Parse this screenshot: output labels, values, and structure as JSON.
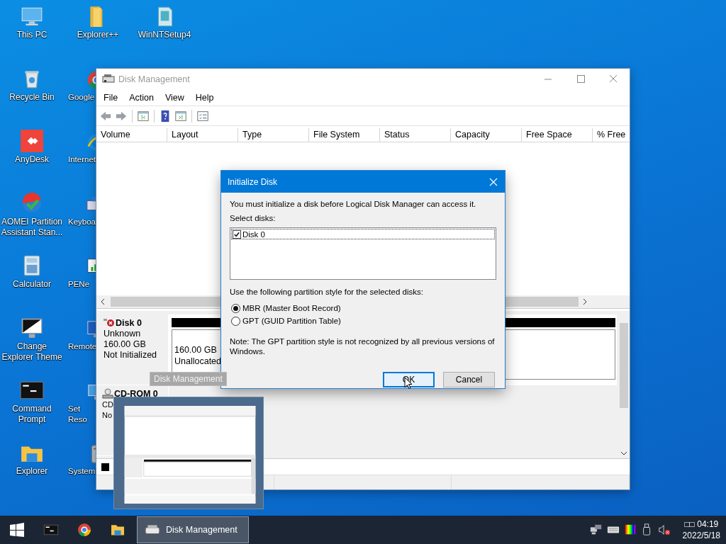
{
  "desktop": {
    "columns": [
      [
        {
          "label": "This PC",
          "kind": "pc"
        },
        {
          "label": "Recycle Bin",
          "kind": "bin"
        },
        {
          "label": "AnyDesk",
          "kind": "anydesk"
        },
        {
          "label": "AOMEI Partition Assistant Stan...",
          "kind": "aomei"
        },
        {
          "label": "Calculator",
          "kind": "calc"
        },
        {
          "label": "Change Explorer Theme",
          "kind": "theme"
        },
        {
          "label": "Command Prompt",
          "kind": "cmd"
        },
        {
          "label": "Explorer",
          "kind": "explorer"
        }
      ],
      [
        {
          "label": "Explorer++",
          "kind": "folder"
        },
        {
          "label": "Google",
          "kind": "chrome"
        },
        {
          "label": "Internet",
          "kind": "ie"
        },
        {
          "label": "Keyboa",
          "kind": "keyboard"
        },
        {
          "label": "PENe",
          "kind": "network"
        },
        {
          "label": "Remote",
          "kind": "remote"
        },
        {
          "label": "Set Reso",
          "kind": "screen"
        },
        {
          "label": "System",
          "kind": "system"
        }
      ],
      [
        {
          "label": "WinNTSetup4",
          "kind": "setup"
        }
      ]
    ]
  },
  "window": {
    "title": "Disk Management",
    "active": false,
    "menu": [
      "File",
      "Action",
      "View",
      "Help"
    ],
    "columns": [
      "Volume",
      "Layout",
      "Type",
      "File System",
      "Status",
      "Capacity",
      "Free Space",
      "% Free"
    ],
    "disks": [
      {
        "name": "Disk 0",
        "kind": "disk",
        "lines": [
          "Unknown",
          "160.00 GB",
          "Not Initialized"
        ],
        "partition": [
          "160.00 GB",
          "Unallocated"
        ]
      },
      {
        "name": "CD-ROM 0",
        "kind": "cdrom",
        "lines": [
          "CD",
          "No"
        ]
      }
    ]
  },
  "tooltip": "Disk Management",
  "dialog": {
    "title": "Initialize Disk",
    "message": "You must initialize a disk before Logical Disk Manager can access it.",
    "select_label": "Select disks:",
    "disks": [
      {
        "label": "Disk 0",
        "checked": true,
        "selected": true
      }
    ],
    "style_label": "Use the following partition style for the selected disks:",
    "partition_styles": [
      {
        "label": "MBR (Master Boot Record)",
        "selected": true
      },
      {
        "label": "GPT (GUID Partition Table)",
        "selected": false
      }
    ],
    "note": "Note: The GPT partition style is not recognized by all previous versions of Windows.",
    "buttons": [
      {
        "label": "OK",
        "default": true
      },
      {
        "label": "Cancel",
        "default": false
      }
    ]
  },
  "taskbar": {
    "pinned": [
      {
        "kind": "cmd"
      },
      {
        "kind": "chrome"
      },
      {
        "kind": "explorer"
      }
    ],
    "tasks": [
      {
        "label": "Disk Management",
        "selected": true
      }
    ],
    "time": "□□ 04:19",
    "date": "2022/5/18"
  }
}
